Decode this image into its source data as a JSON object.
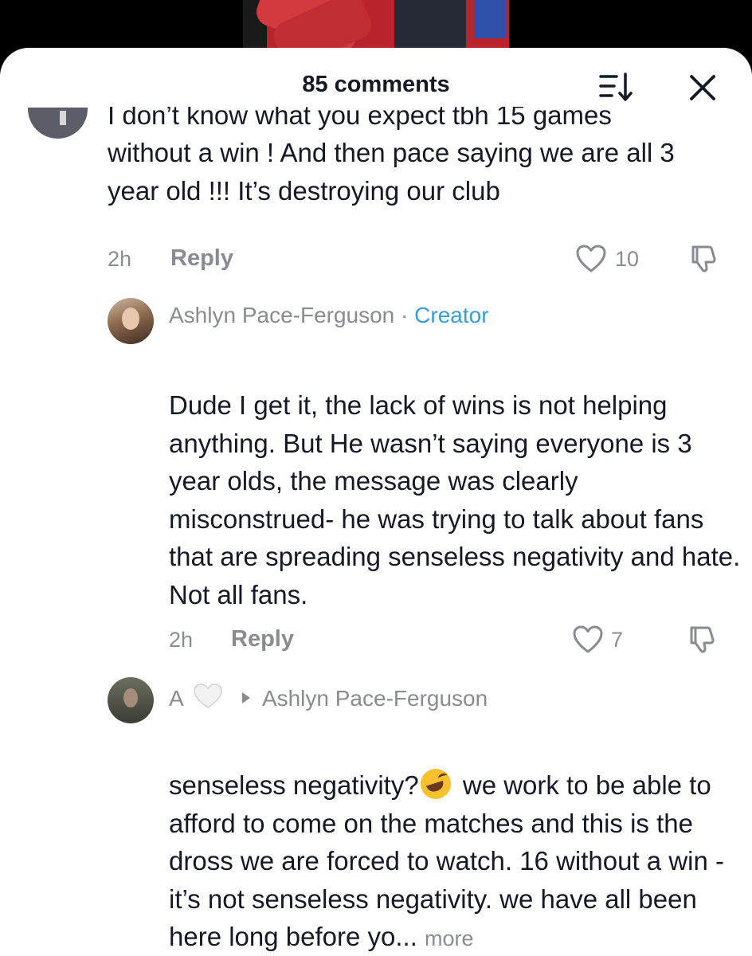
{
  "header": {
    "comment_count": "85 comments"
  },
  "icons": {
    "sort": "sort-icon",
    "close": "close-icon",
    "like": "heart-outline-icon",
    "dislike": "thumbs-down-icon"
  },
  "comments": [
    {
      "text_line1": "I don’t know what you expect tbh 15 games",
      "text_rest": "without a win ! And then pace saying we are all 3 year old !!! It’s destroying our club",
      "time": "2h",
      "reply_label": "Reply",
      "likes": "10"
    },
    {
      "username": "Ashlyn Pace-Ferguson",
      "separator": "·",
      "badge": "Creator",
      "text": "Dude I get it, the lack of wins is not helping anything. But He wasn’t saying everyone is 3 year olds, the message was clearly misconstrued- he was trying to talk about fans that are spreading senseless negativity and hate. Not all fans.",
      "time": "2h",
      "reply_label": "Reply",
      "likes": "7"
    },
    {
      "username": "A",
      "reply_to": "Ashlyn Pace-Ferguson",
      "text_before_emoji": "senseless negativity?",
      "text_after_emoji": " we work to be able to afford to come on the matches and this is the dross we are forced to watch. 16 without a win - it’s not senseless negativity. we have all been here long before yo...",
      "more_label": "more"
    }
  ],
  "colors": {
    "text": "#161823",
    "secondary": "#8a8b91",
    "creator": "#3a9cd8"
  }
}
